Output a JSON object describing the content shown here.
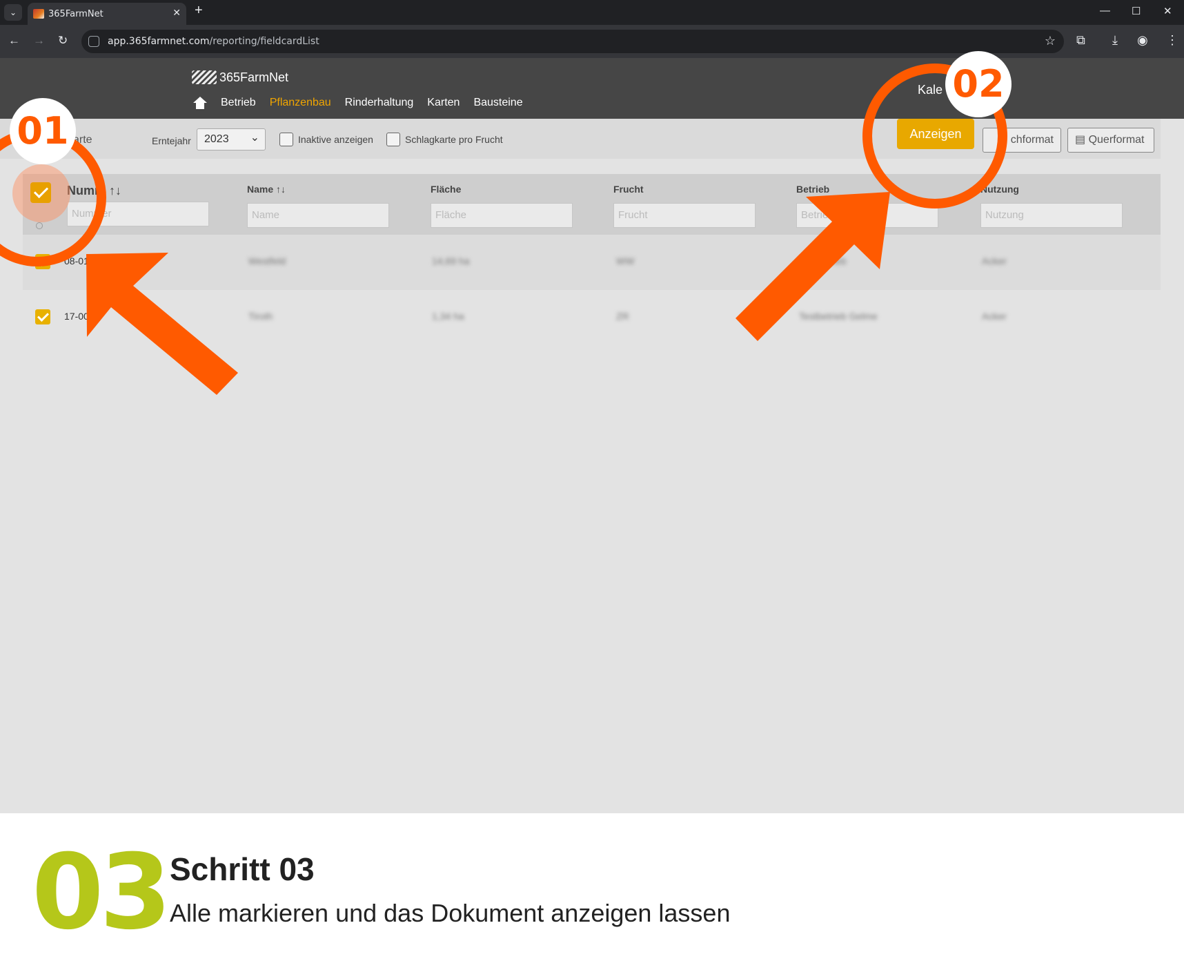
{
  "browser": {
    "tab_title": "365FarmNet",
    "url_host": "app.365farmnet.com",
    "url_path": "/reporting/fieldcardList"
  },
  "app": {
    "logo_text": "365FarmNet",
    "nav": [
      "Betrieb",
      "Pflanzenbau",
      "Rinderhaltung",
      "Karten",
      "Bausteine"
    ],
    "header_right": "Kale"
  },
  "filterbar": {
    "title_fragment": "arte",
    "year_label": "Erntejahr",
    "year_value": "2023",
    "inactive_label": "Inaktive anzeigen",
    "per_crop_label": "Schlagkarte pro Frucht",
    "show_button": "Anzeigen",
    "portrait_button": "chformat",
    "landscape_button": "Querformat"
  },
  "table": {
    "columns": [
      "Numm",
      "Name",
      "Fläche",
      "Frucht",
      "Betrieb",
      "Nutzung"
    ],
    "filter_placeholders": [
      "Nummer",
      "Name",
      "Fläche",
      "Frucht",
      "Betrieb",
      "Nutzung"
    ],
    "rows": [
      {
        "number": "08-01",
        "name": "Westfeld",
        "area": "14,69 ha",
        "crop": "WW",
        "farm": "Testbetrieb",
        "usage": "Acker"
      },
      {
        "number": "17-00",
        "name": "Tiroth",
        "area": "1,34 ha",
        "crop": "ZR",
        "farm": "Testbetrieb Gelme",
        "usage": "Acker"
      }
    ]
  },
  "annotations": {
    "badge1": "01",
    "badge2": "02",
    "color": "#ff5a00"
  },
  "caption": {
    "step_number": "03",
    "title": "Schritt 03",
    "description": "Alle markieren und das Dokument anzeigen lassen",
    "step_color": "#b5c71a"
  }
}
